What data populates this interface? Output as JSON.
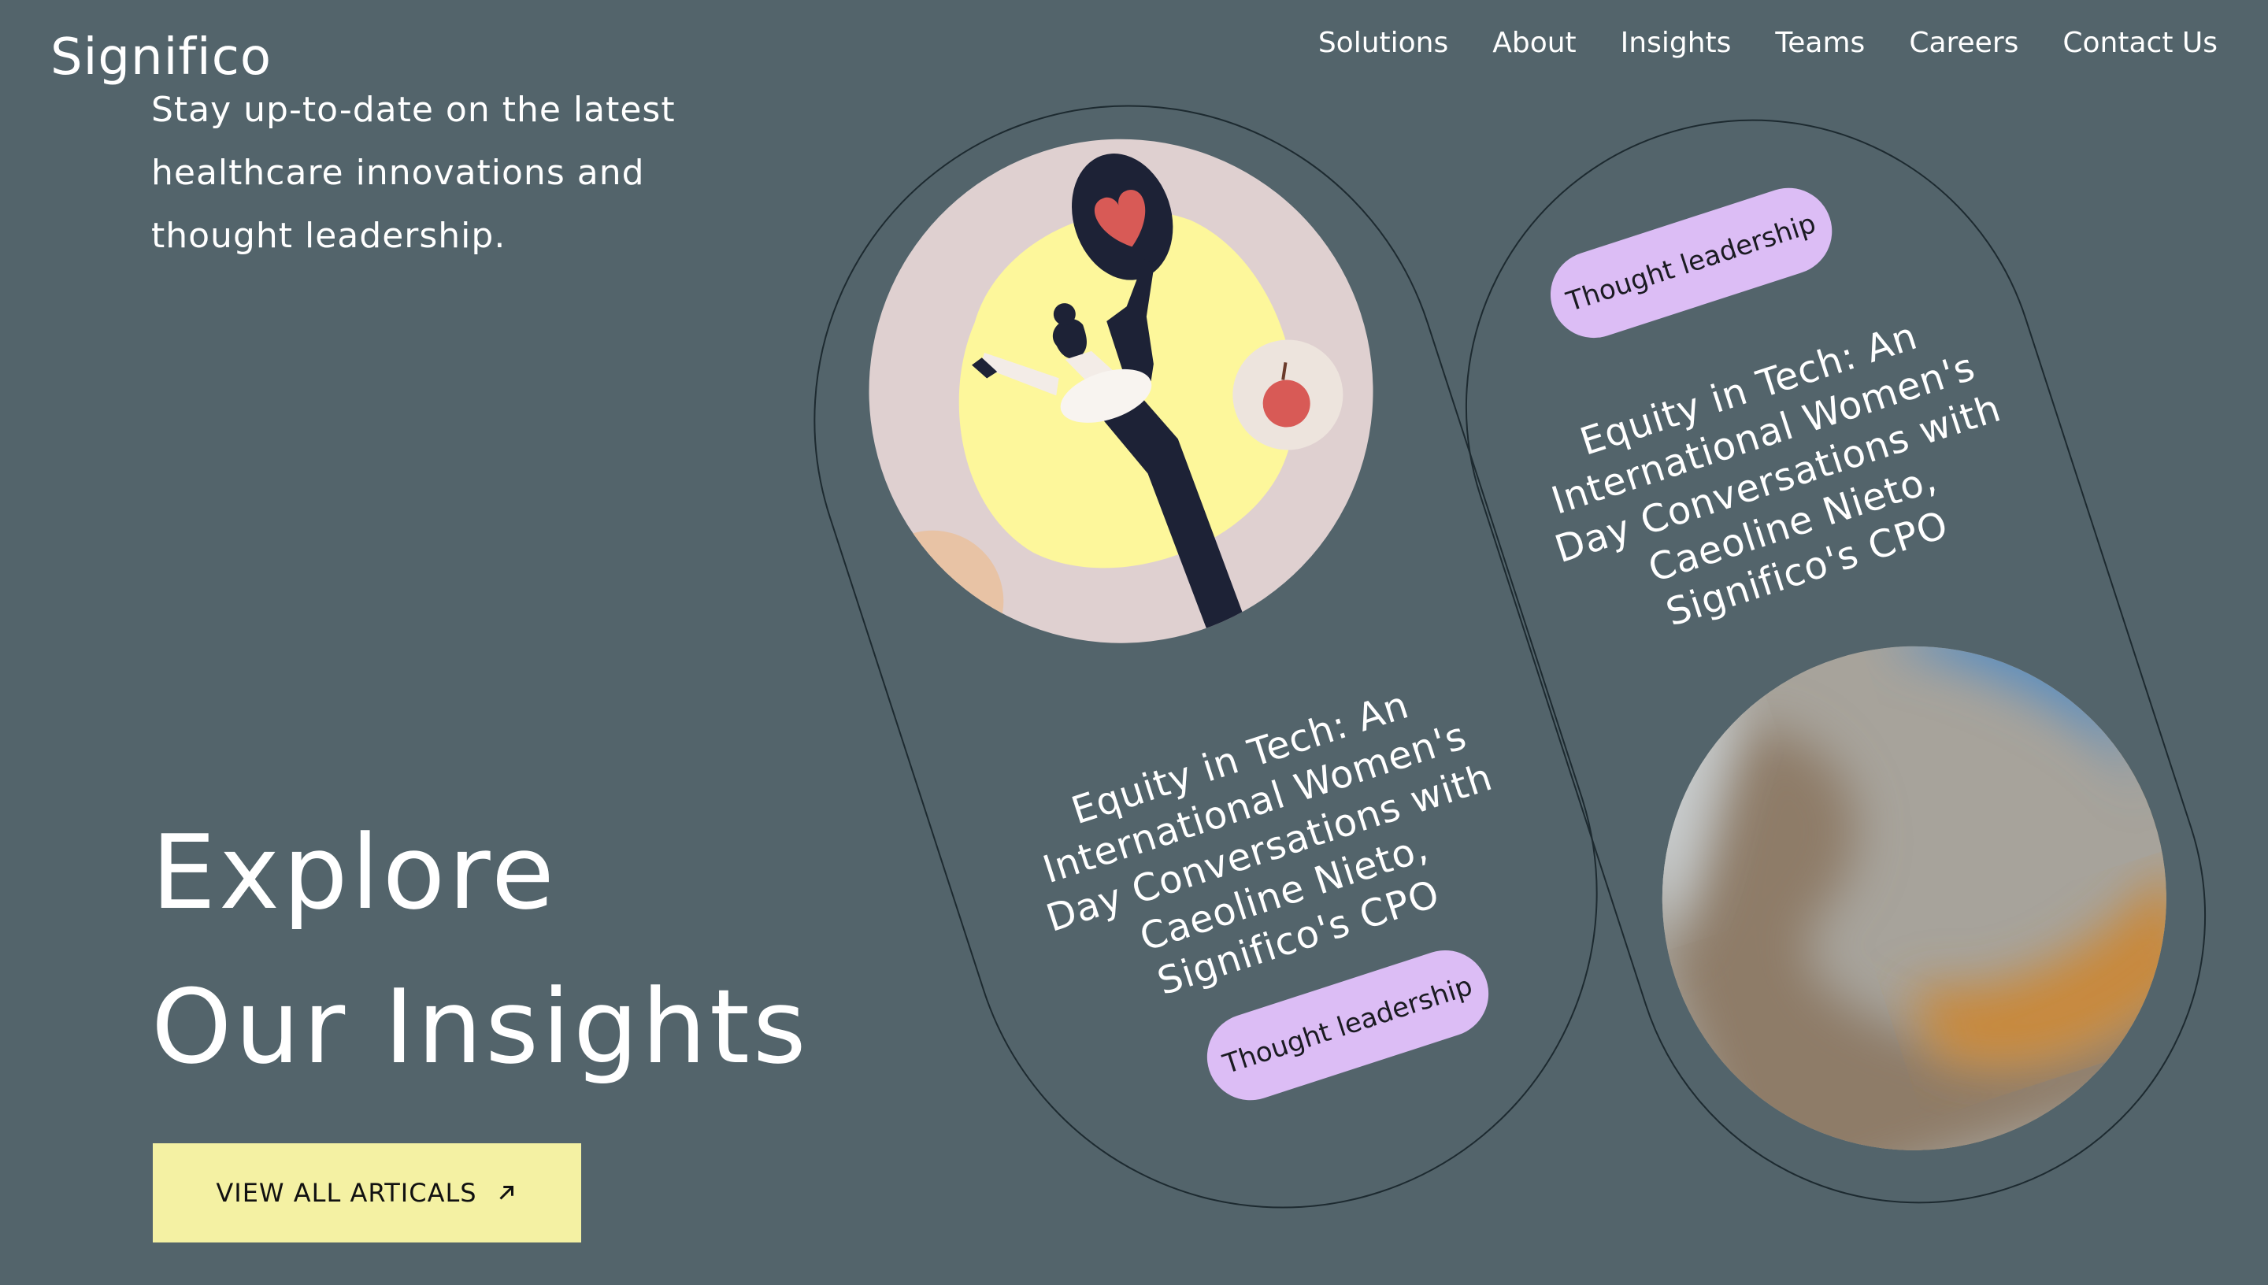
{
  "header": {
    "logo": "Significo",
    "nav": [
      "Solutions",
      "About",
      "Insights",
      "Teams",
      "Careers",
      "Contact Us"
    ]
  },
  "hero": {
    "intro": "Stay up-to-date on the latest healthcare innovations and thought leadership.",
    "headline_line1": "Explore",
    "headline_line2": "Our Insights",
    "cta_label": "VIEW ALL ARTICALS"
  },
  "cards": [
    {
      "title": "Equity in Tech: An International Women's Day Conversations with Caeoline Nieto, Significo's CPO",
      "tag": "Thought leadership",
      "image": "illustration-woman-heart"
    },
    {
      "title": "Equity in Tech: An International Women's Day Conversations with Caeoline Nieto, Significo's CPO",
      "tag": "Thought leadership",
      "image": "abstract-gradient-blur"
    }
  ],
  "colors": {
    "background": "#53646b",
    "cta": "#f4f1a3",
    "tag": "#dcbdf5"
  },
  "icons": {
    "cta_arrow": "arrow-up-right-icon"
  }
}
